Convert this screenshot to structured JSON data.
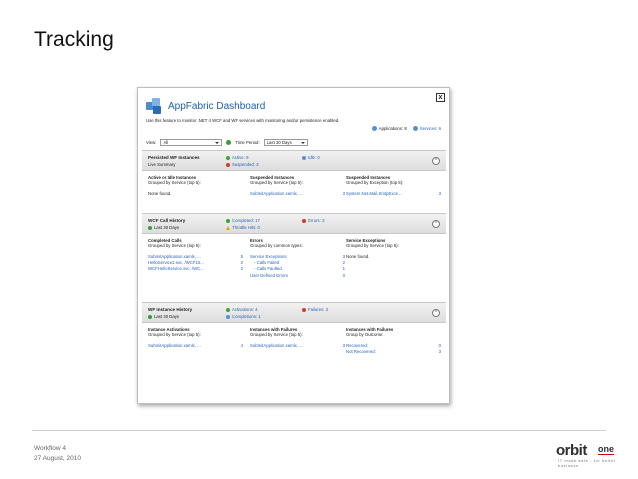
{
  "slide": {
    "title": "Tracking",
    "footer_line1": "Workflow 4",
    "footer_line2": "27 August, 2010",
    "logo_word1": "orbit",
    "logo_word2": "one",
    "logo_tagline": "IT made safe - for better business"
  },
  "dashboard": {
    "title": "AppFabric Dashboard",
    "close_glyph": "x",
    "description": "Use this feature to monitor .NET 4 WCF and WF services with monitoring and/or persistence enabled.",
    "applications_label": "Applications: 8",
    "services_label": "Services: 6",
    "view_label": "View:",
    "view_value": "All",
    "time_period_label": "Time Period:",
    "time_period_value": "Last 30 Days"
  },
  "persisted": {
    "title": "Persisted WF Instances",
    "subtitle": "Live Summary",
    "active": "Active: 9",
    "idle": "Idle: 0",
    "suspended": "Suspended: 3",
    "col1": {
      "h1": "Active or Idle Instances",
      "h2": "Grouped by Service (top 5):",
      "rows": [
        {
          "k": "None found.",
          "v": ""
        }
      ]
    },
    "col2": {
      "h1": "Suspended Instances",
      "h2": "Grouped by Service (top 5):",
      "rows": [
        {
          "k": "SubmitApplication.xamlx, ...",
          "v": "3"
        }
      ]
    },
    "col3": {
      "h1": "Suspended Instances",
      "h2": "Grouped by Exception (top 5):",
      "rows": [
        {
          "k": "System.Net.Mail.SmtpExce...",
          "v": "3"
        }
      ]
    }
  },
  "wcf": {
    "title": "WCF Call History",
    "subtitle": "Last 30 Days",
    "completed": "Completed: 17",
    "errors": "Errors: 3",
    "throttle": "Throttle Hits: 0",
    "col1": {
      "h1": "Completed Calls",
      "h2": "Grouped by Service (top 5):",
      "rows": [
        {
          "k": "SubmitApplication.xamlx, ...",
          "v": "5"
        },
        {
          "k": "HelloService2.svc, /WCF10...",
          "v": "2"
        },
        {
          "k": "WCFHelloService.svc, /WC...",
          "v": "2"
        }
      ]
    },
    "col2": {
      "h1": "Errors",
      "h2": "Grouped by common types:",
      "rows": [
        {
          "k": "Service Exceptions",
          "v": "3"
        },
        {
          "k": "- Calls Failed",
          "v": "2"
        },
        {
          "k": "- Calls Faulted",
          "v": "1"
        },
        {
          "k": "User Defined Errors",
          "v": "0"
        }
      ]
    },
    "col3": {
      "h1": "Service Exceptions",
      "h2": "Grouped by Service (top 5):",
      "rows": [
        {
          "k": "None found.",
          "v": ""
        }
      ]
    }
  },
  "wf": {
    "title": "WF Instance History",
    "subtitle": "Last 30 Days",
    "activations": "Activations: 4",
    "failures": "Failures: 3",
    "completions": "Completions: 1",
    "col1": {
      "h1": "Instance Activations",
      "h2": "Grouped by Service (top 5):",
      "rows": [
        {
          "k": "SubmitApplication.xamlx, ...",
          "v": "4"
        }
      ]
    },
    "col2": {
      "h1": "Instances with Failures",
      "h2": "Grouped by Service (top 5):",
      "rows": [
        {
          "k": "SubmitApplication.xamlx, ...",
          "v": "3"
        }
      ]
    },
    "col3": {
      "h1": "Instances with Failures",
      "h2": "Group by Outcome:",
      "rows": [
        {
          "k": "Recovered:",
          "v": "0"
        },
        {
          "k": "Not Recovered:",
          "v": "3"
        }
      ]
    }
  },
  "icons": {
    "collapse": "chevron-up-icon",
    "close": "close-icon",
    "app": "appfabric-logo-icon"
  }
}
